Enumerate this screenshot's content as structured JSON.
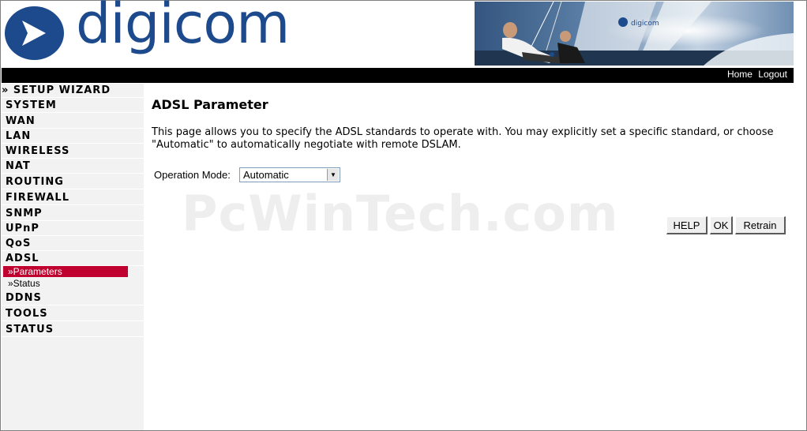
{
  "header": {
    "logo_text": "digicom",
    "banner_brand": "digicom",
    "links": {
      "home": "Home",
      "logout": "Logout"
    }
  },
  "sidebar": {
    "wizard": "» SETUP WIZARD",
    "items": [
      "SYSTEM",
      "WAN",
      "LAN",
      "WIRELESS",
      "NAT",
      "ROUTING",
      "FIREWALL",
      "SNMP",
      "UPnP",
      "QoS",
      "ADSL"
    ],
    "adsl_sub": [
      "»Parameters",
      "»Status"
    ],
    "items_after": [
      "DDNS",
      "TOOLS",
      "STATUS"
    ]
  },
  "main": {
    "title": "ADSL Parameter",
    "description": "This page allows you to specify the ADSL standards to operate with. You may explicitly set a specific standard, or choose \"Automatic\" to automatically negotiate with remote DSLAM.",
    "operation_mode_label": "Operation Mode:",
    "operation_mode_value": "Automatic",
    "buttons": {
      "help": "HELP",
      "ok": "OK",
      "retrain": "Retrain"
    }
  },
  "watermark": "PcWinTech.com",
  "colors": {
    "brand_blue": "#1c4a8c",
    "active_red": "#c0002e",
    "topbar": "#000000",
    "sidebar_bg": "#f2f2f2"
  }
}
